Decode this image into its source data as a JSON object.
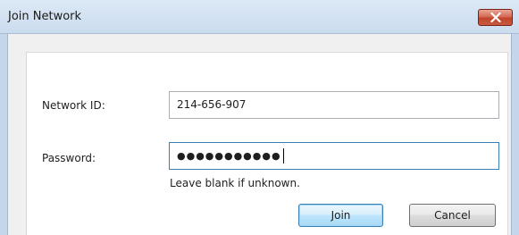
{
  "window": {
    "title": "Join Network",
    "close_icon": "close-icon",
    "accent_color": "#c65a41"
  },
  "form": {
    "network_id_label": "Network ID:",
    "network_id_value": "214-656-907",
    "password_label": "Password:",
    "password_value": "●●●●●●●●●●●",
    "password_hint": "Leave blank if unknown."
  },
  "buttons": {
    "join_label": "Join",
    "cancel_label": "Cancel"
  }
}
